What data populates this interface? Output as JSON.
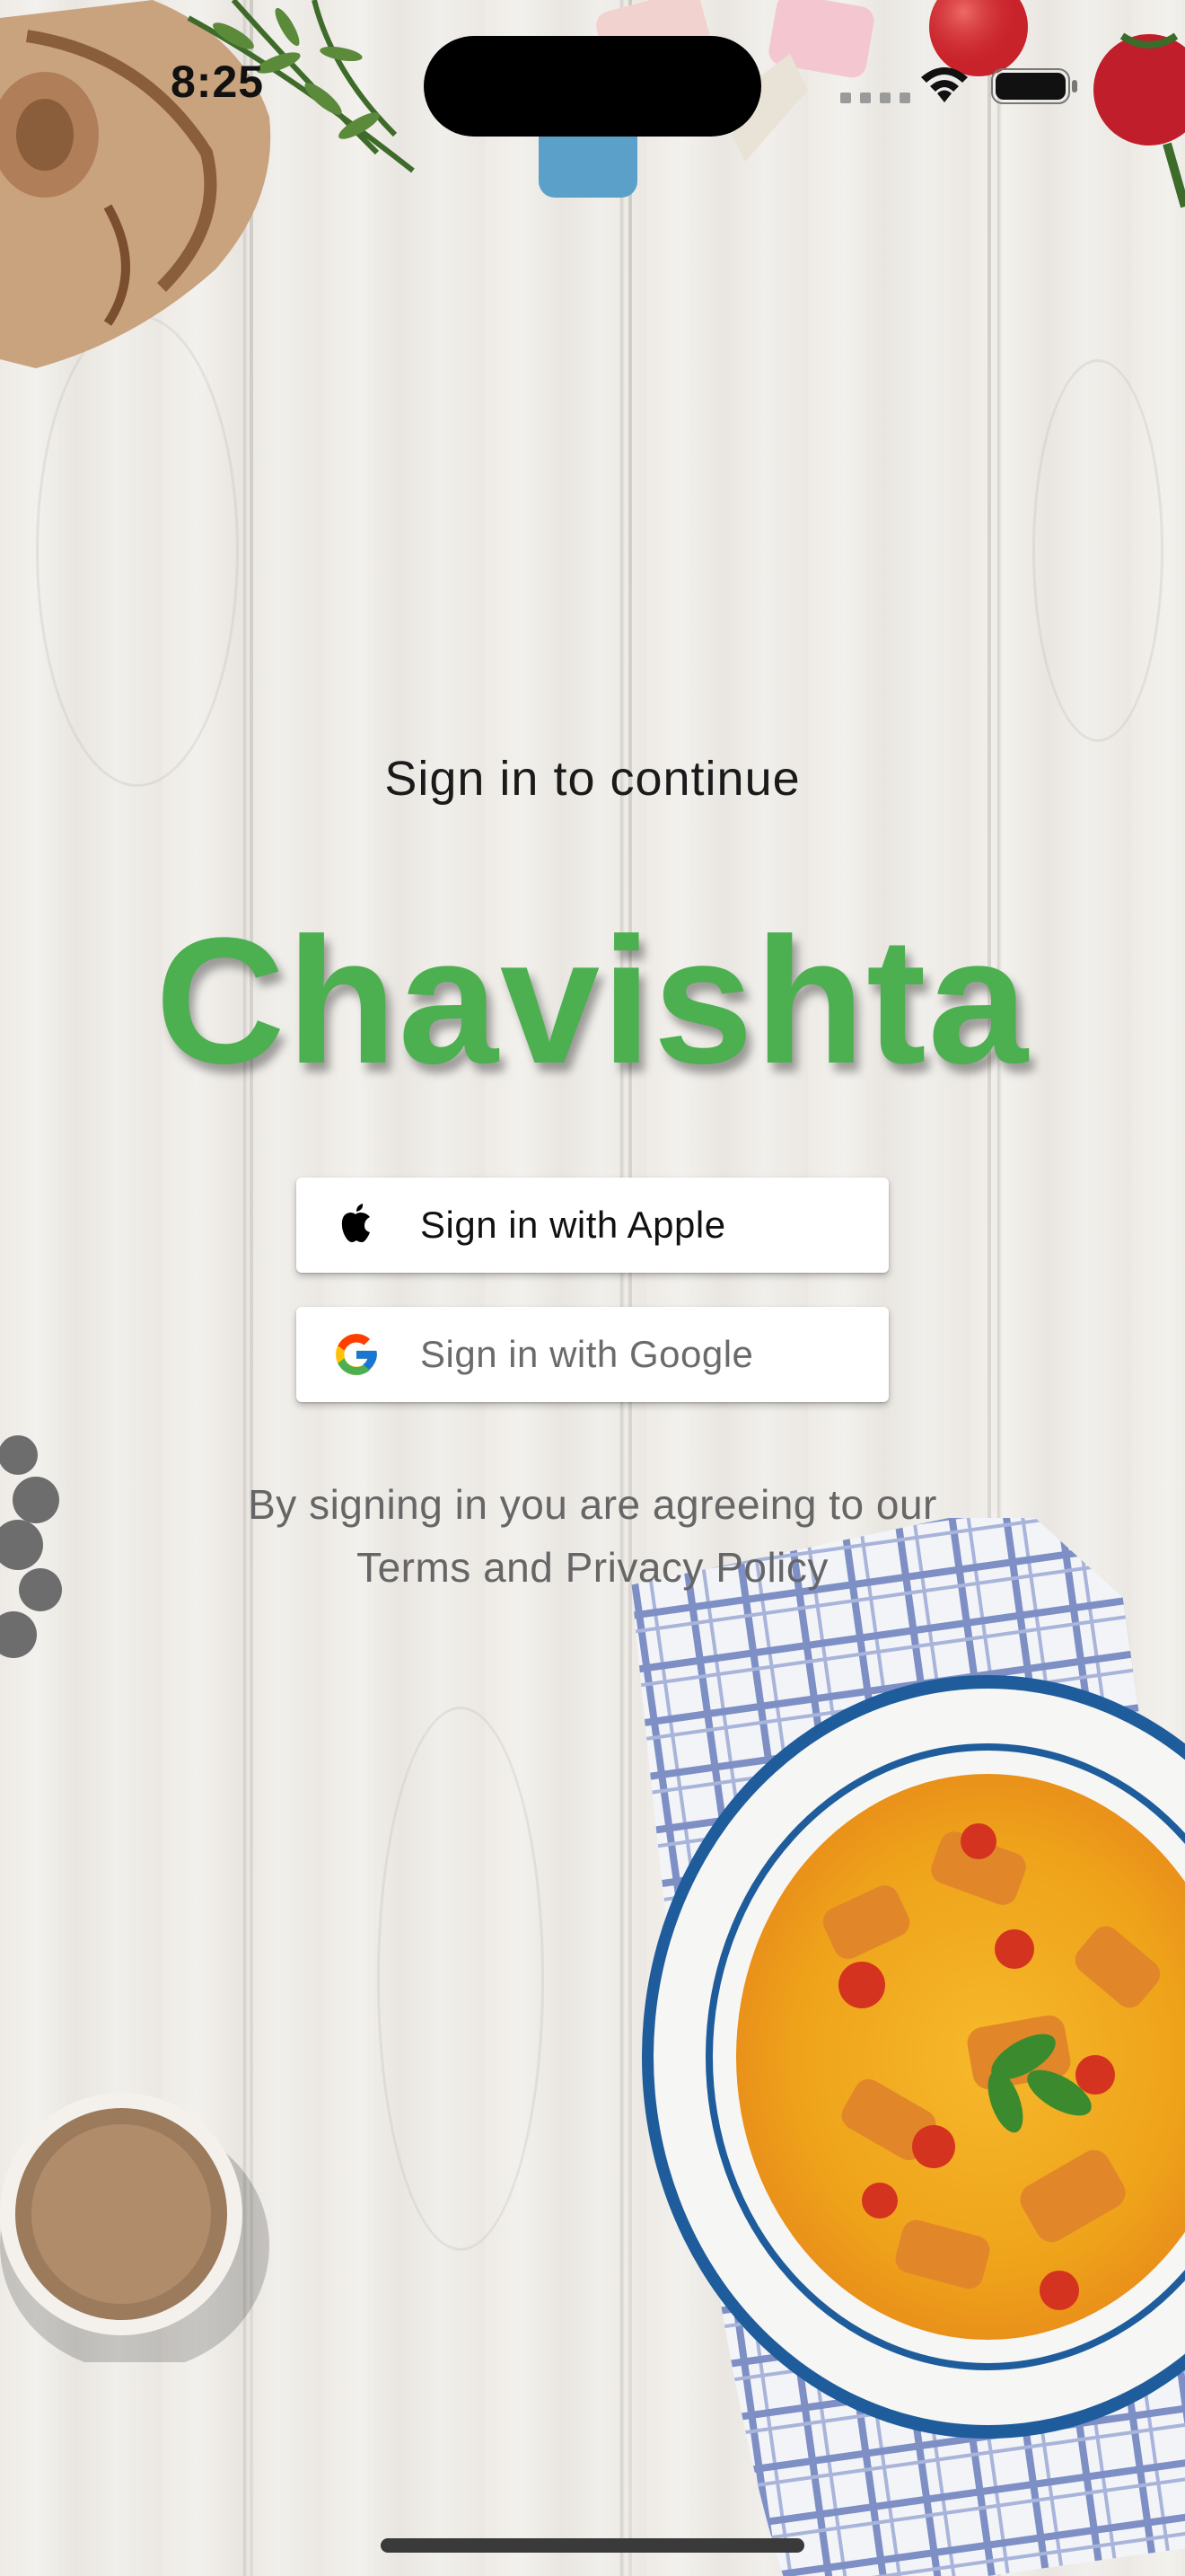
{
  "status_bar": {
    "time": "8:25",
    "icons": [
      "cellular-icon",
      "wifi-icon",
      "battery-icon"
    ]
  },
  "main": {
    "subtitle": "Sign in to continue",
    "app_name": "Chavishta",
    "brand_color": "#4caf50",
    "buttons": {
      "apple_label": "Sign in with Apple",
      "google_label": "Sign in with Google"
    },
    "legal_line1": "By signing in you are agreeing to our",
    "legal_line2": "Terms and Privacy Policy"
  }
}
